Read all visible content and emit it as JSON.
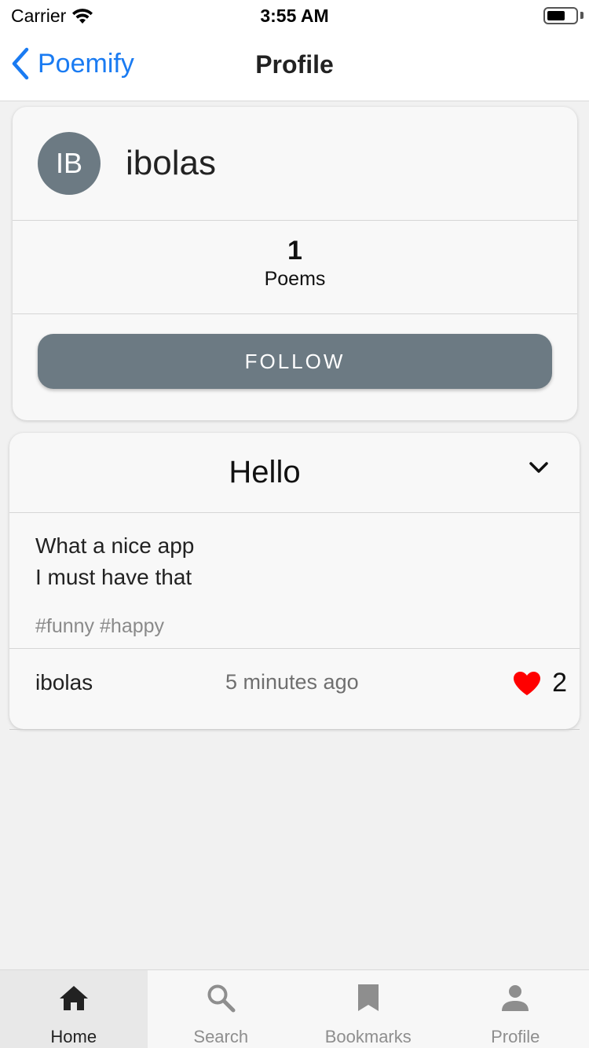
{
  "status_bar": {
    "carrier": "Carrier",
    "time": "3:55 AM"
  },
  "nav": {
    "back_label": "Poemify",
    "title": "Profile"
  },
  "profile": {
    "avatar_initials": "IB",
    "username": "ibolas",
    "stats": {
      "count": "1",
      "label": "Poems"
    },
    "follow_label": "FOLLOW"
  },
  "poem": {
    "title": "Hello",
    "lines": [
      "What a nice app",
      "I must have that"
    ],
    "tags": "#funny #happy",
    "author": "ibolas",
    "time": "5 minutes ago",
    "likes": "2"
  },
  "tabs": [
    {
      "label": "Home",
      "icon": "home-icon",
      "active": true
    },
    {
      "label": "Search",
      "icon": "search-icon",
      "active": false
    },
    {
      "label": "Bookmarks",
      "icon": "bookmark-icon",
      "active": false
    },
    {
      "label": "Profile",
      "icon": "person-icon",
      "active": false
    }
  ],
  "colors": {
    "accent": "#1a7bf2",
    "avatar": "#6c7a83",
    "button": "#6c7a83",
    "heart": "#ff0000"
  }
}
